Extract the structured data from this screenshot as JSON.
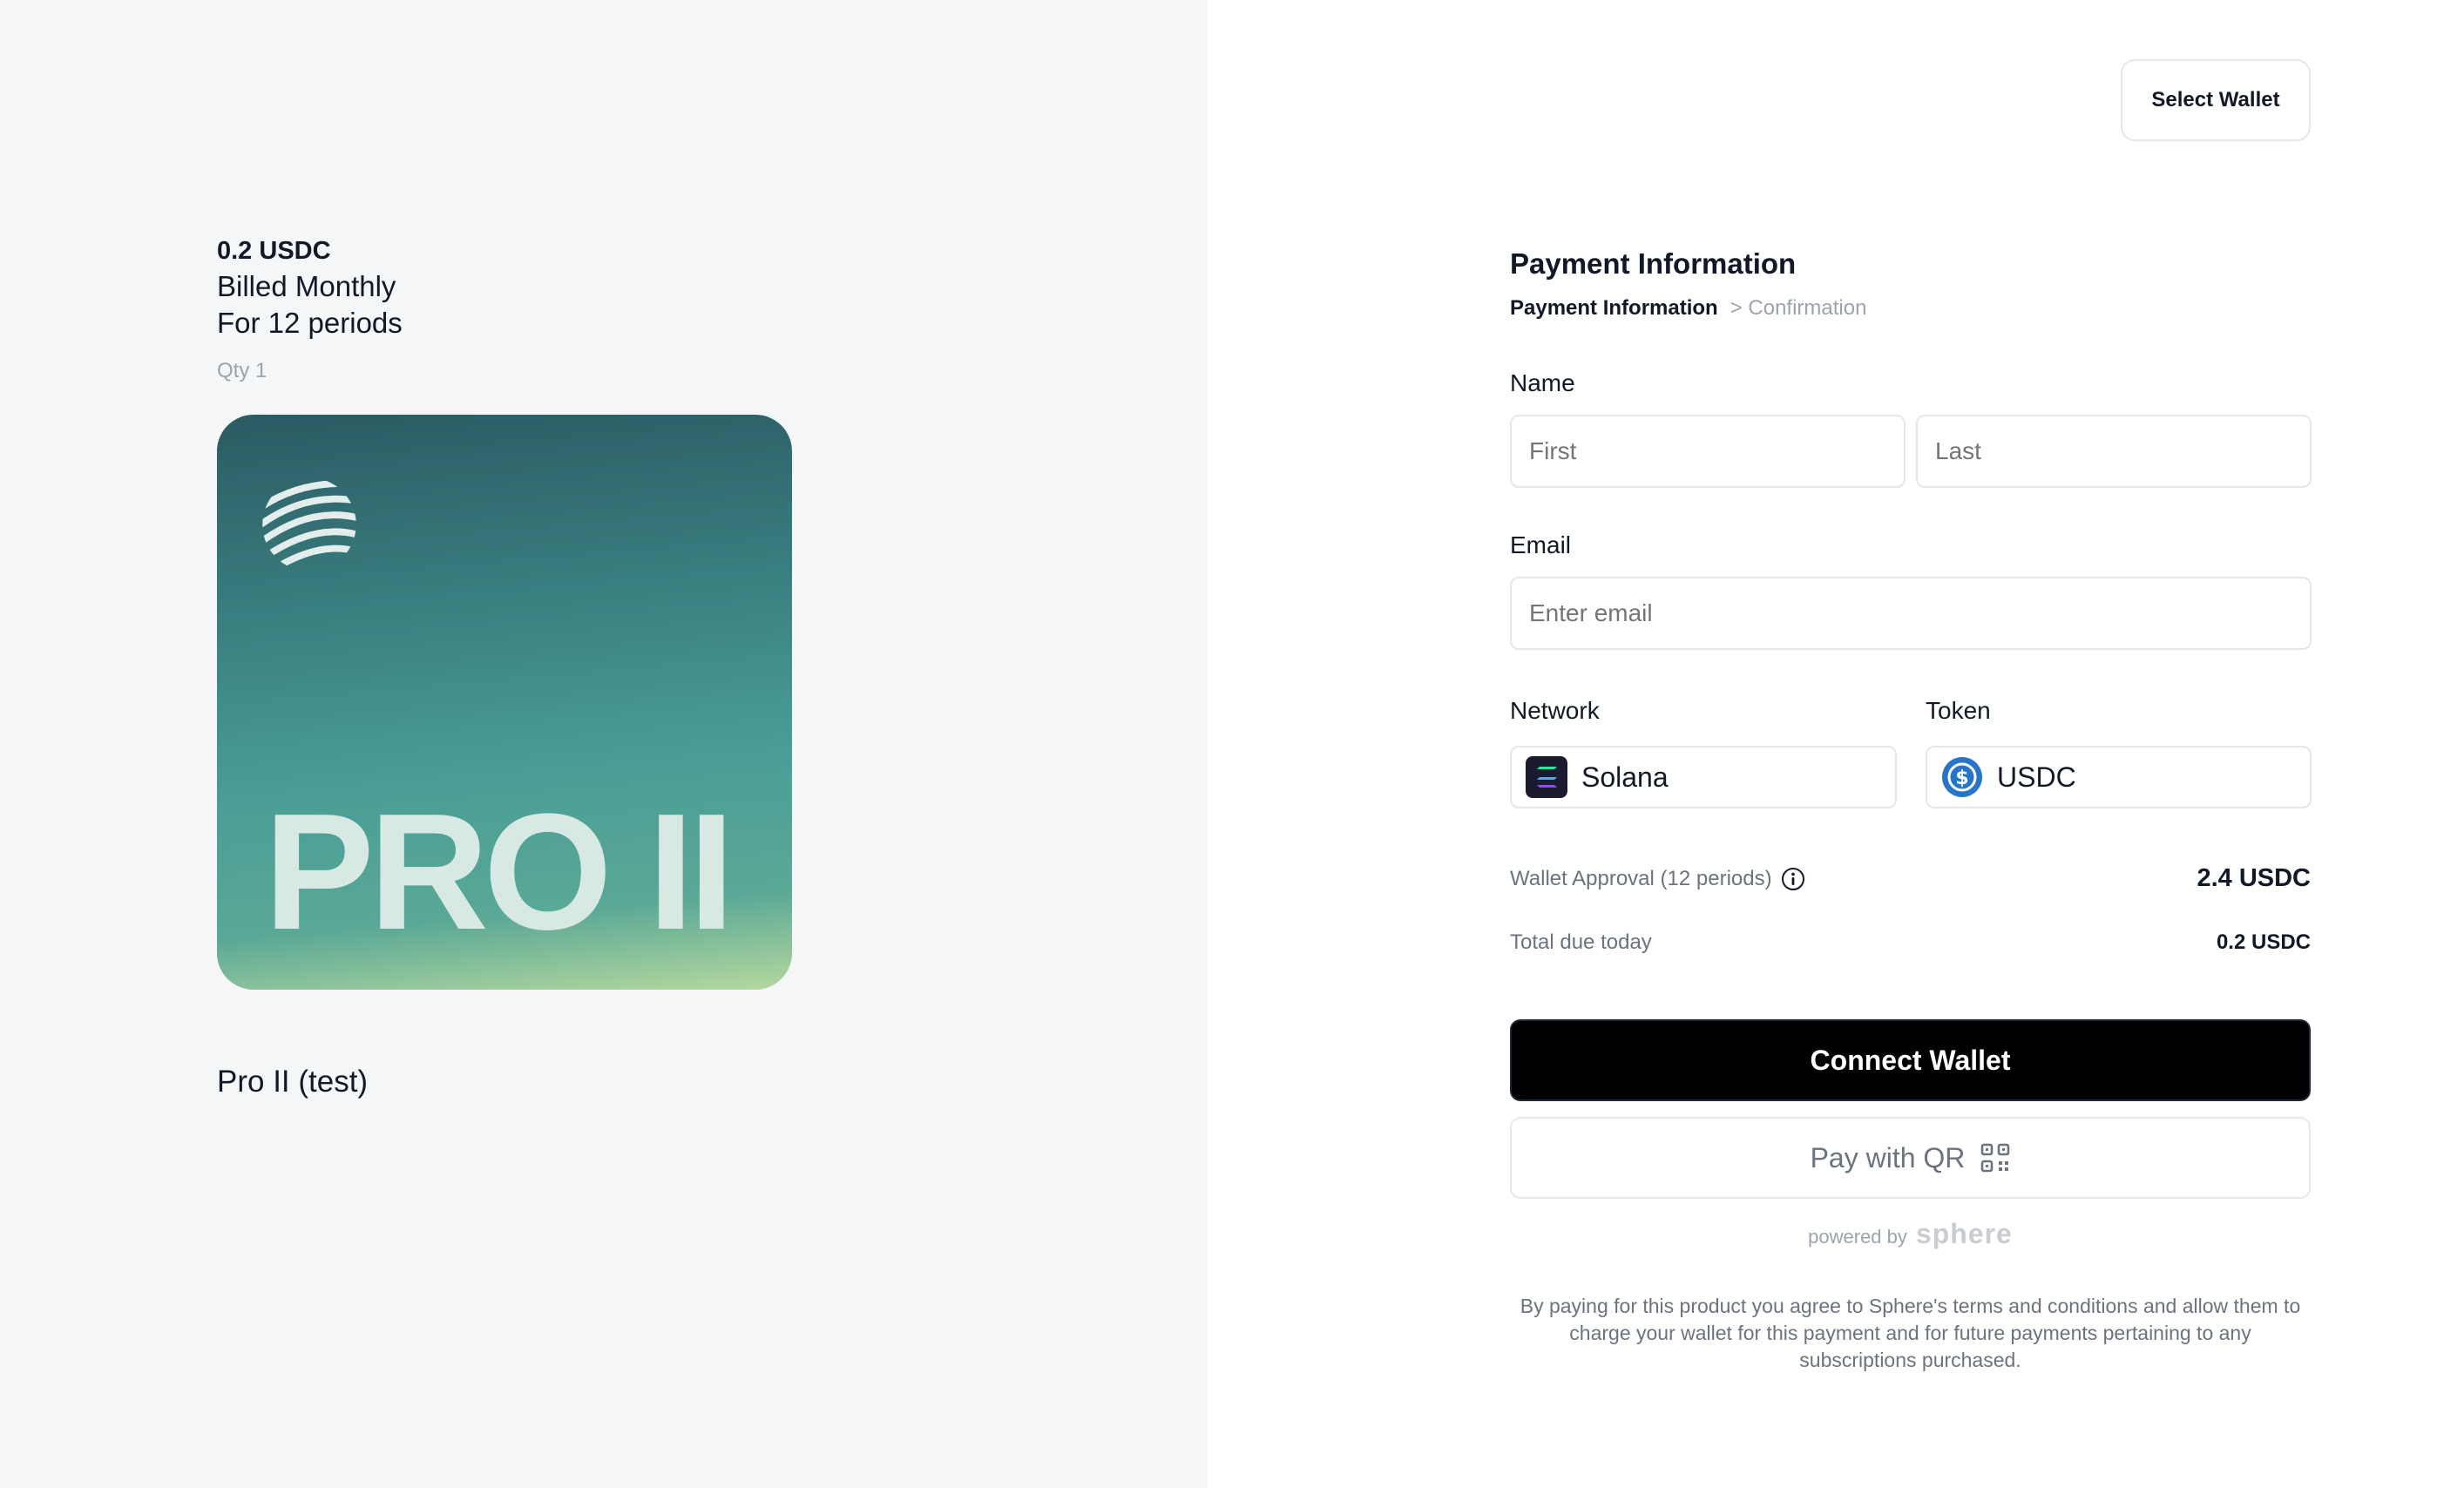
{
  "summary": {
    "price": "0.2 USDC",
    "billing_line1": "Billed Monthly",
    "billing_line2": "For 12 periods",
    "qty": "Qty 1",
    "card_text": "PRO II",
    "product_name": "Pro II (test)"
  },
  "header": {
    "select_wallet_label": "Select Wallet"
  },
  "form": {
    "title": "Payment Information",
    "breadcrumb_active": "Payment Information",
    "breadcrumb_next": "> Confirmation",
    "name_label": "Name",
    "first_placeholder": "First",
    "last_placeholder": "Last",
    "email_label": "Email",
    "email_placeholder": "Enter email",
    "network_label": "Network",
    "network_value": "Solana",
    "network_icon": "solana-icon",
    "token_label": "Token",
    "token_value": "USDC",
    "token_icon": "usdc-icon"
  },
  "totals": {
    "approval_label": "Wallet Approval (12 periods)",
    "approval_value": "2.4 USDC",
    "due_label": "Total due today",
    "due_value": "0.2 USDC"
  },
  "actions": {
    "connect_label": "Connect Wallet",
    "qr_label": "Pay with QR"
  },
  "footer": {
    "powered_by": "powered by",
    "brand": "sphere",
    "terms": "By paying for this product you agree to Sphere's terms and conditions and allow them to charge your wallet for this payment and for future payments pertaining to any subscriptions purchased."
  },
  "colors": {
    "primary_button": "#000000",
    "usdc_blue": "#2775ca",
    "left_background": "#f5f6f8"
  }
}
